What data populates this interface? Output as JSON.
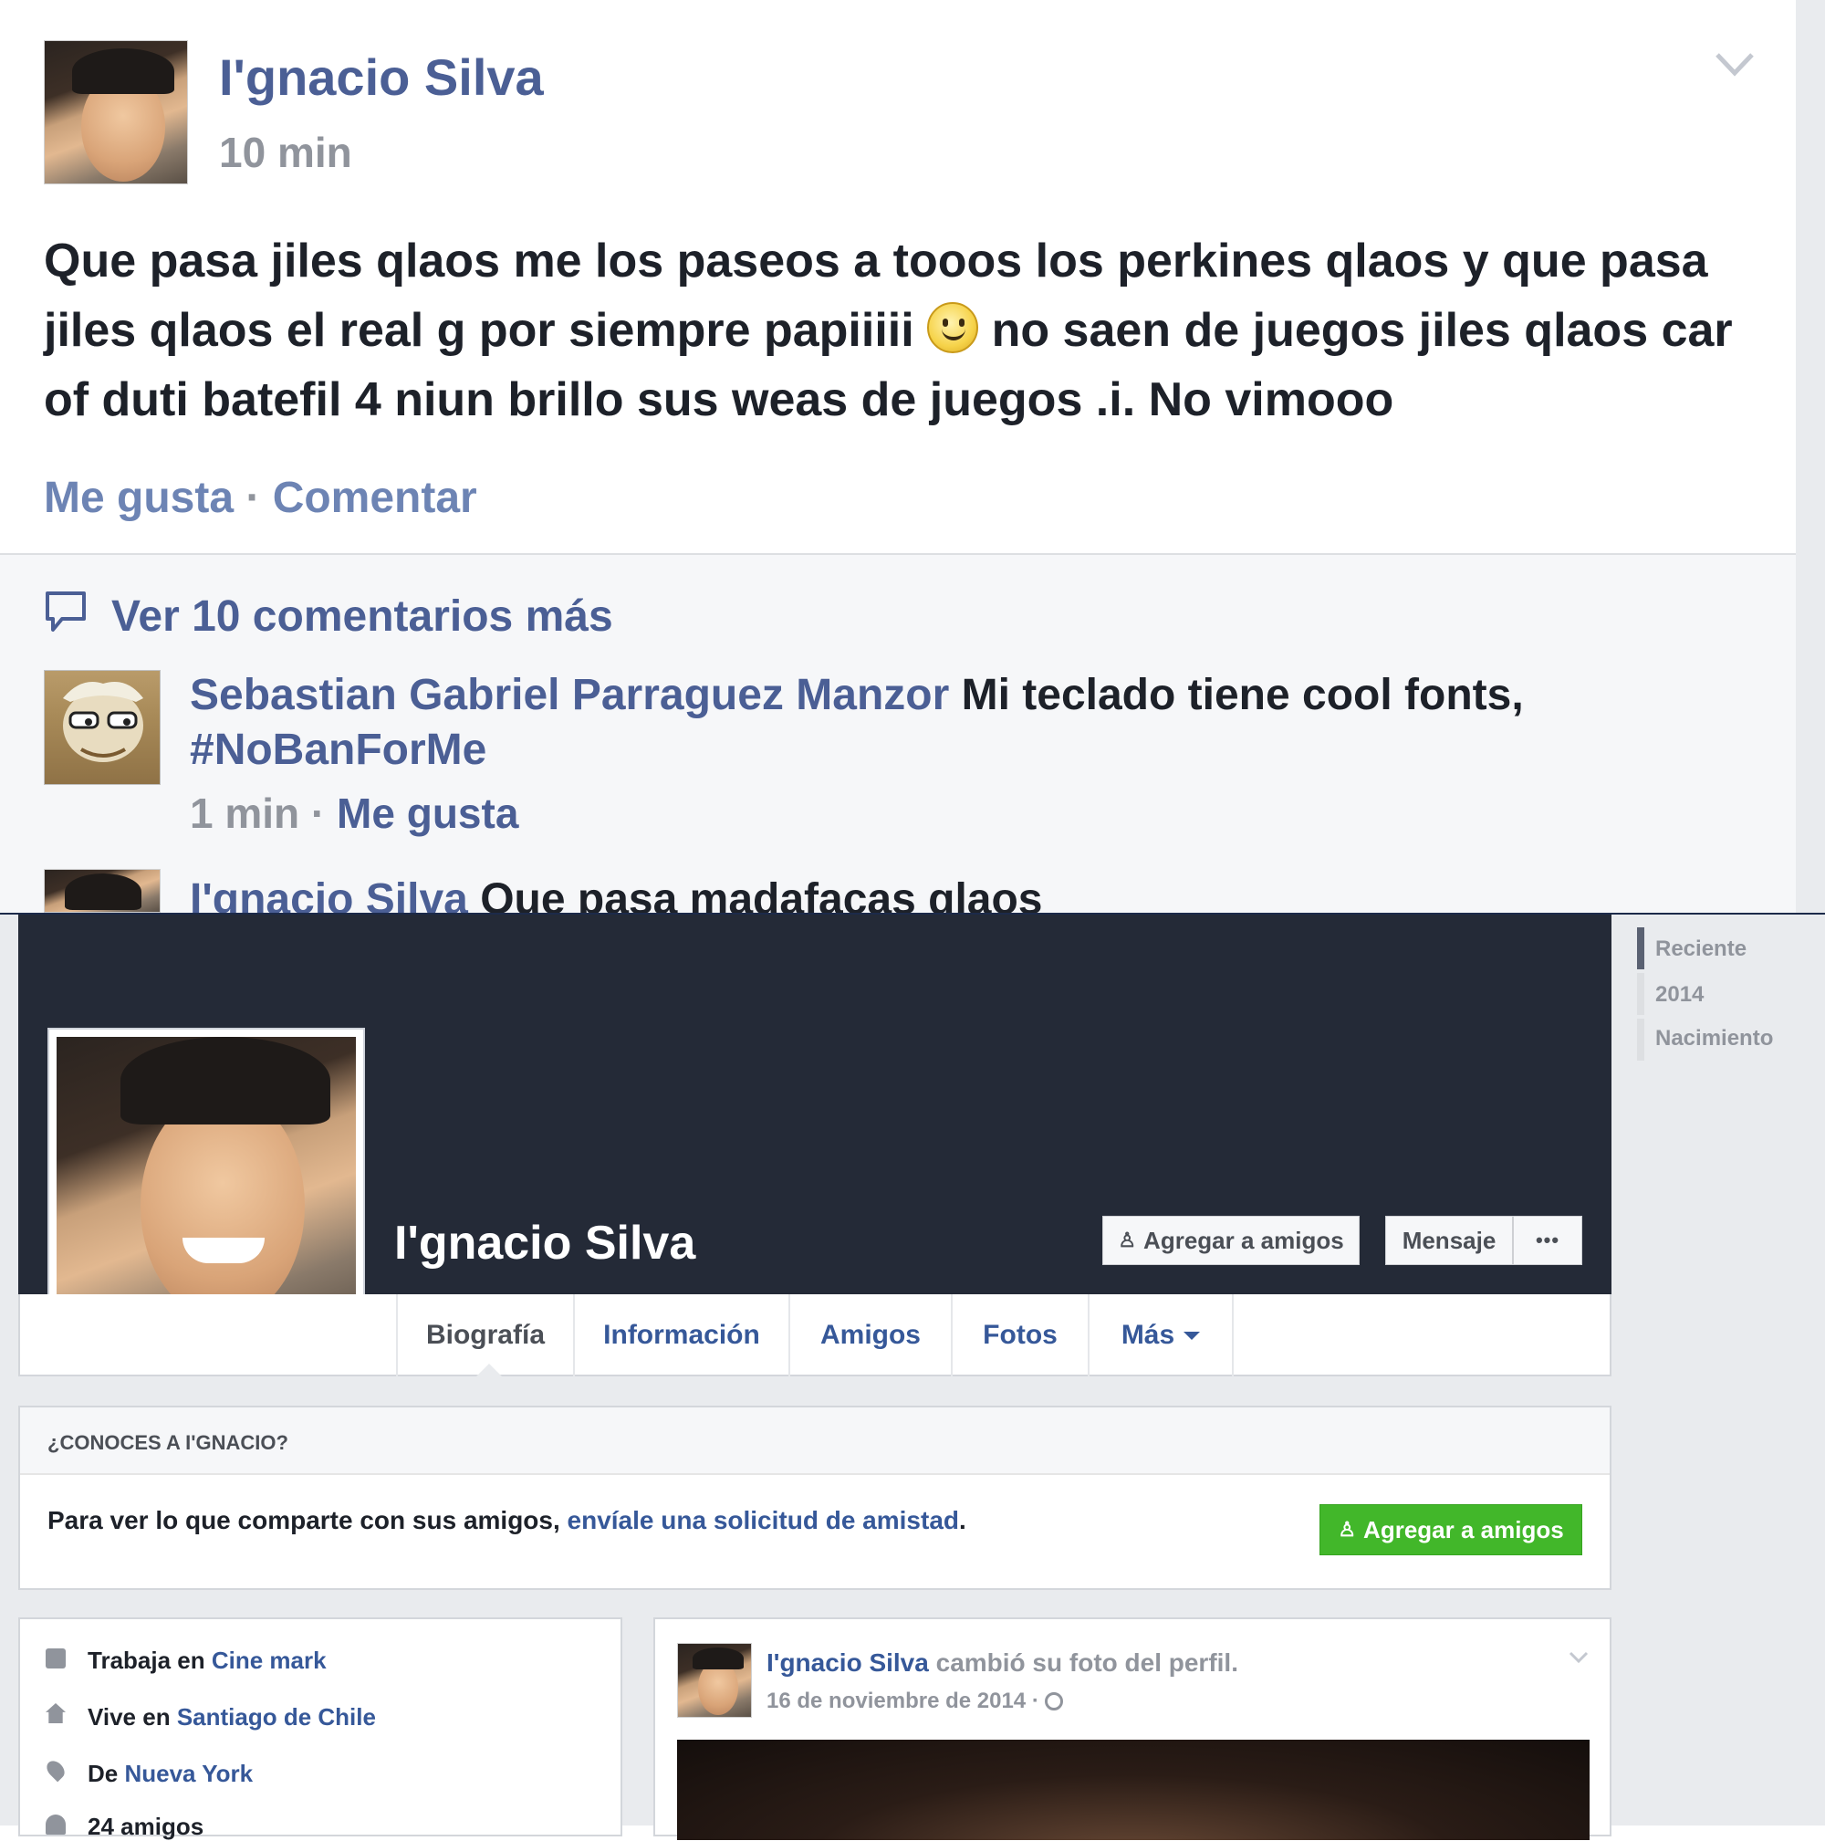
{
  "post": {
    "author": "I'gnacio Silva",
    "time": "10 min",
    "text_part1": "Que pasa jiles qlaos me los paseos a tooos los perkines qlaos y que pasa jiles qlaos el real g por siempre papiiiii ",
    "text_part2": " no saen de juegos jiles qlaos car of duti batefil 4 niun brillo sus weas de juegos .i. No vimooo",
    "like_label": "Me gusta",
    "separator": " · ",
    "comment_label": "Comentar",
    "icons": {
      "options": "chevron-down-icon",
      "emoji": "smiley-icon"
    }
  },
  "comments": {
    "more_label": "Ver 10 comentarios más",
    "items": [
      {
        "author": "Sebastian Gabriel Parraguez Manzor",
        "text": "Mi teclado tiene cool fonts,",
        "hashtag": "#NoBanForMe",
        "time": "1 min",
        "like_label": "Me gusta"
      },
      {
        "author": "I'gnacio Silva",
        "text": "Que pasa madafacas qlaos"
      }
    ]
  },
  "profile": {
    "name": "I'gnacio Silva",
    "add_friend_label": "Agregar a amigos",
    "message_label": "Mensaje",
    "more_dots": "•••",
    "tabs": [
      "Biografía",
      "Información",
      "Amigos",
      "Fotos",
      "Más"
    ]
  },
  "know": {
    "title": "¿CONOCES A I'GNACIO?",
    "text_before": "Para ver lo que comparte con sus amigos, ",
    "link": "envíale una solicitud de amistad",
    "text_after": ".",
    "button_label": "Agregar a amigos"
  },
  "intro": {
    "work_prefix": "Trabaja en ",
    "work_place": "Cine mark",
    "lives_prefix": "Vive en ",
    "lives_place": "Santiago de Chile",
    "from_prefix": "De ",
    "from_place": "Nueva York",
    "friends": "24 amigos"
  },
  "feed_post": {
    "author": "I'gnacio Silva",
    "action": " cambió su foto del perfil.",
    "date": "16 de noviembre de 2014",
    "separator": " · "
  },
  "timeline": [
    "Reciente",
    "2014",
    "Nacimiento"
  ],
  "colors": {
    "link_blue": "#4b5f95",
    "cover_dark": "#242a37",
    "green_button": "#42b72a",
    "page_bg": "#e9ebee"
  }
}
